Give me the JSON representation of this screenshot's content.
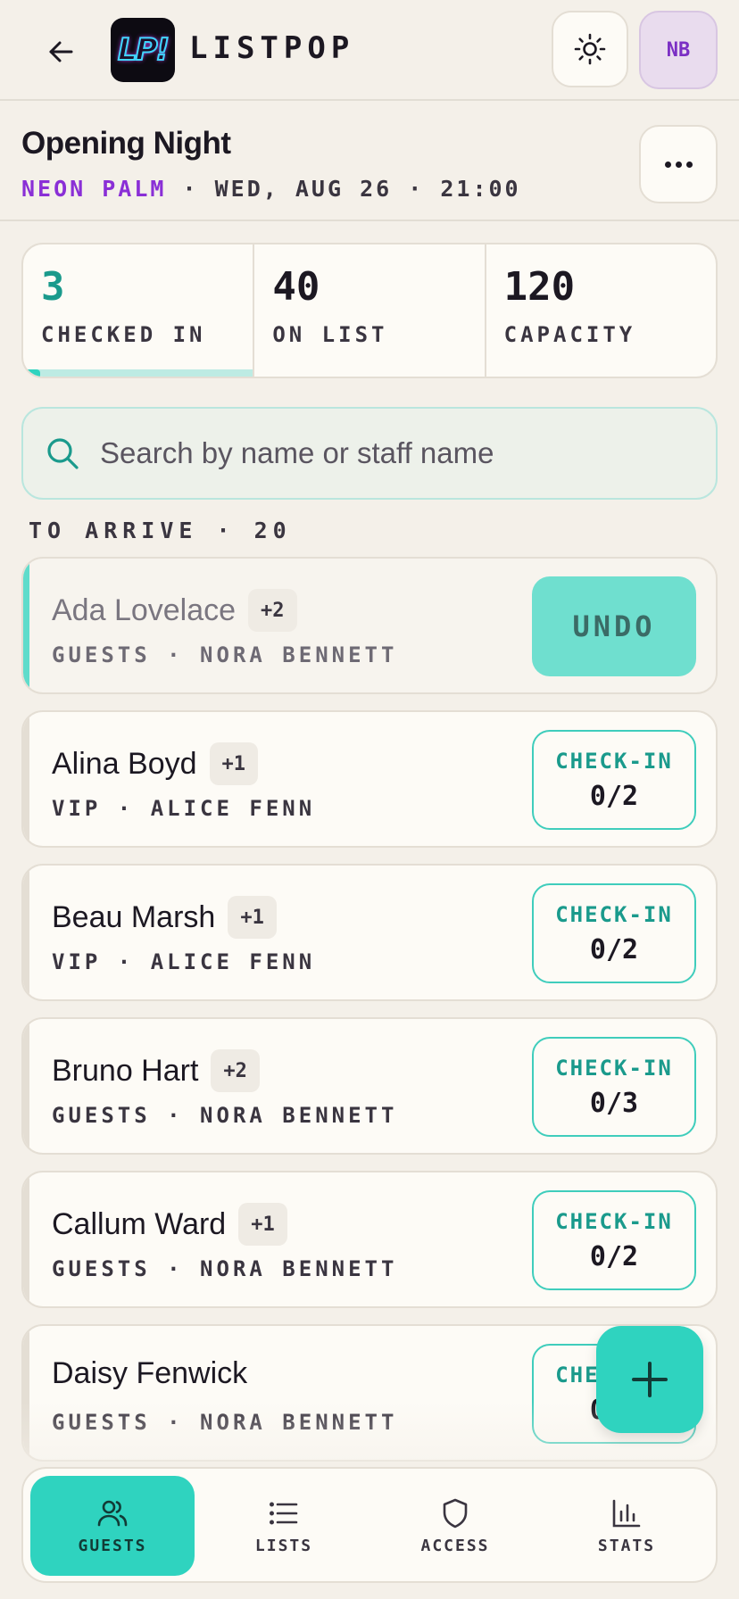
{
  "app": {
    "logo_text": "LP!",
    "brand": "LISTPOP",
    "user_initials": "NB"
  },
  "event": {
    "title": "Opening Night",
    "venue": "NEON PALM",
    "details": " · WED, AUG 26 · 21:00"
  },
  "stats": [
    {
      "value": "3",
      "label": "CHECKED IN"
    },
    {
      "value": "40",
      "label": "ON LIST"
    },
    {
      "value": "120",
      "label": "CAPACITY"
    }
  ],
  "checked_in_fraction_of_list": 0.075,
  "search": {
    "placeholder": "Search by name or staff name",
    "value": ""
  },
  "section": {
    "label": "TO ARRIVE · 20"
  },
  "guests": [
    {
      "name": "Ada Lovelace",
      "plus": "+2",
      "meta": "GUESTS · NORA BENNETT",
      "checked_in": true,
      "action": "UNDO"
    },
    {
      "name": "Alina Boyd",
      "plus": "+1",
      "meta": "VIP · ALICE FENN",
      "checked_in": false,
      "action": "CHECK-IN",
      "count": "0/2"
    },
    {
      "name": "Beau Marsh",
      "plus": "+1",
      "meta": "VIP · ALICE FENN",
      "checked_in": false,
      "action": "CHECK-IN",
      "count": "0/2"
    },
    {
      "name": "Bruno Hart",
      "plus": "+2",
      "meta": "GUESTS · NORA BENNETT",
      "checked_in": false,
      "action": "CHECK-IN",
      "count": "0/3"
    },
    {
      "name": "Callum Ward",
      "plus": "+1",
      "meta": "GUESTS · NORA BENNETT",
      "checked_in": false,
      "action": "CHECK-IN",
      "count": "0/2"
    },
    {
      "name": "Daisy Fenwick",
      "plus": "",
      "meta": "GUESTS · NORA BENNETT",
      "checked_in": false,
      "action": "CHECK-IN",
      "count": "0/2"
    }
  ],
  "nav": [
    {
      "label": "GUESTS",
      "icon": "users-icon",
      "active": true
    },
    {
      "label": "LISTS",
      "icon": "list-icon",
      "active": false
    },
    {
      "label": "ACCESS",
      "icon": "shield-icon",
      "active": false
    },
    {
      "label": "STATS",
      "icon": "bar-chart-icon",
      "active": false
    }
  ],
  "colors": {
    "accent": "#2fd3bf",
    "accent_text": "#1a9a8c",
    "venue": "#8a2fd6",
    "background": "#f4f0e9"
  }
}
